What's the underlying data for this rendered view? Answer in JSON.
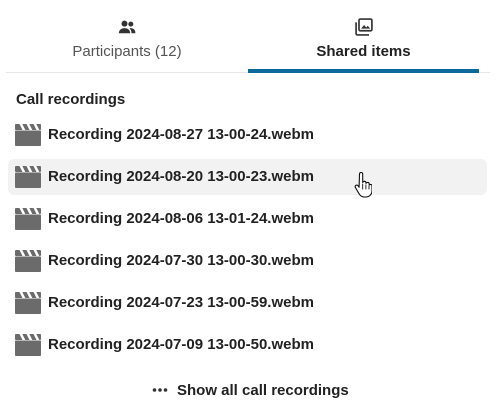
{
  "tabs": [
    {
      "label": "Participants (12)",
      "icon": "people-icon",
      "selected": false
    },
    {
      "label": "Shared items",
      "icon": "images-icon",
      "selected": true
    }
  ],
  "accent_color": "#0b6a9b",
  "section": {
    "title": "Call recordings",
    "recordings": [
      {
        "name": "Recording 2024-08-27 13-00-24.webm",
        "icon": "video-file-icon"
      },
      {
        "name": "Recording 2024-08-20 13-00-23.webm",
        "icon": "video-file-icon",
        "hovered": true
      },
      {
        "name": "Recording 2024-08-06 13-01-24.webm",
        "icon": "video-file-icon"
      },
      {
        "name": "Recording 2024-07-30 13-00-30.webm",
        "icon": "video-file-icon"
      },
      {
        "name": "Recording 2024-07-23 13-00-59.webm",
        "icon": "video-file-icon"
      },
      {
        "name": "Recording 2024-07-09 13-00-50.webm",
        "icon": "video-file-icon"
      }
    ]
  },
  "show_all": {
    "label": "Show all call recordings",
    "icon": "dots-horizontal-icon"
  }
}
